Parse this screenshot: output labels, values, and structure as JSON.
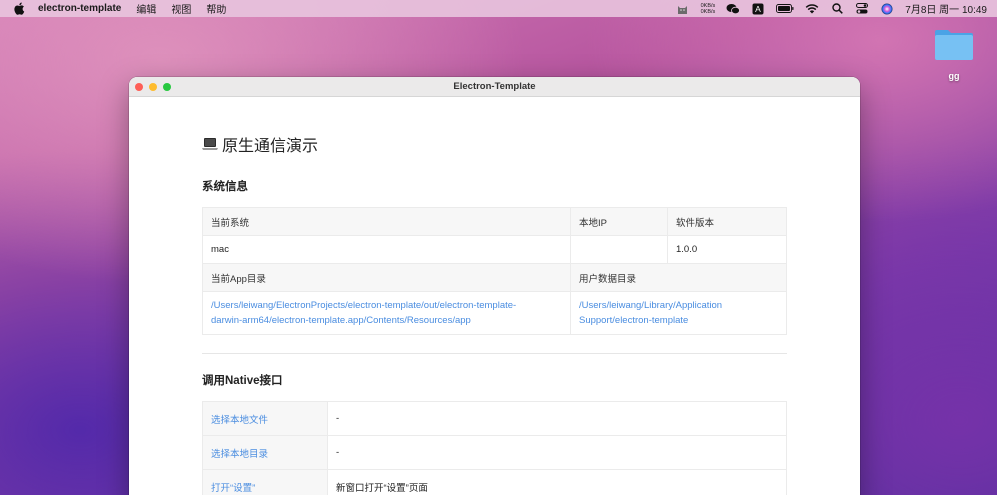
{
  "menubar": {
    "app_name": "electron-template",
    "menus": [
      "编辑",
      "视图",
      "帮助"
    ],
    "net_up": "0KB/s",
    "net_down": "0KB/s",
    "clock": "7月8日 周一  10:49",
    "icons": [
      "cat-icon",
      "wechat-icon",
      "input-method-icon",
      "battery-icon",
      "wifi-icon",
      "search-icon",
      "control-center-icon",
      "siri-icon"
    ],
    "input_method_letter": "A"
  },
  "desktop": {
    "folder_label": "gg"
  },
  "window": {
    "title": "Electron-Template",
    "page_title": "原生通信演示",
    "system_info": {
      "heading": "系统信息",
      "headers_row1": [
        "当前系统",
        "本地IP",
        "软件版本"
      ],
      "values_row1": [
        "mac",
        "",
        "1.0.0"
      ],
      "headers_row2": [
        "当前App目录",
        "用户数据目录"
      ],
      "app_dir": [
        "/Users/leiwang/ElectronProjects/electron-template/out/electron-template-",
        "darwin-arm64/electron-template.app/Contents/Resources/app"
      ],
      "user_data_dir": [
        "/Users/leiwang/Library/Application",
        "Support/electron-template"
      ]
    },
    "native": {
      "heading": "调用Native接口",
      "rows": [
        {
          "label": "选择本地文件",
          "value": "-"
        },
        {
          "label": "选择本地目录",
          "value": "-"
        },
        {
          "label": "打开“设置”",
          "value": "新窗口打开“设置”页面"
        }
      ]
    }
  },
  "colors": {
    "link": "#4a8de0",
    "close": "#fe5f57",
    "minimize": "#febc2e",
    "maximize": "#28c840"
  }
}
